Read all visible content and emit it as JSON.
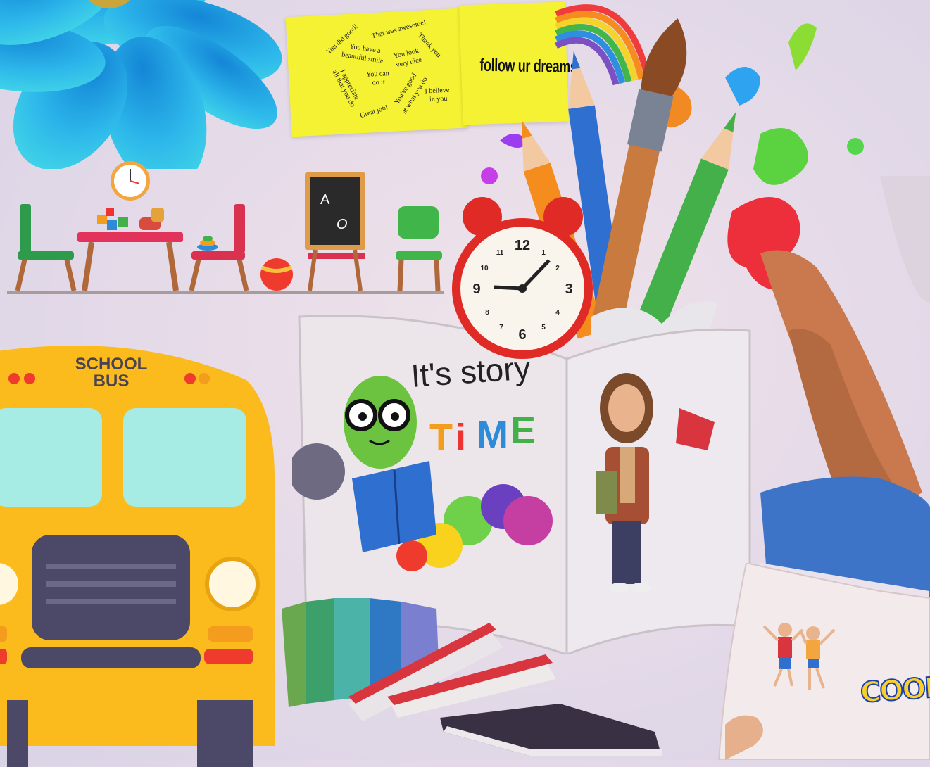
{
  "bus": {
    "label_line1": "SCHOOL",
    "label_line2": "BUS"
  },
  "notes": {
    "phrases": [
      "You did good!",
      "That was awesome!",
      "Thank you",
      "You have a",
      "beautiful smile",
      "You look",
      "very nice",
      "You can",
      "do it",
      "I appreciate",
      "all that you do",
      "You've good",
      "at what you do",
      "I believe",
      "in you",
      "Great job!"
    ],
    "follow": "follow ur dreams"
  },
  "chalkboard": {
    "letters": [
      "A",
      "O"
    ]
  },
  "clock": {
    "numbers": [
      "12",
      "1",
      "2",
      "3",
      "4",
      "5",
      "6",
      "7",
      "8",
      "9",
      "10",
      "11"
    ]
  },
  "story": {
    "line1": "It's story",
    "time_letters": [
      "T",
      "i",
      "M",
      "E"
    ]
  },
  "cool": "COOL",
  "colors": {
    "bus_yellow": "#fbbb1d",
    "note_yellow": "#f4f232",
    "flower_blue": "#27a7e6"
  }
}
